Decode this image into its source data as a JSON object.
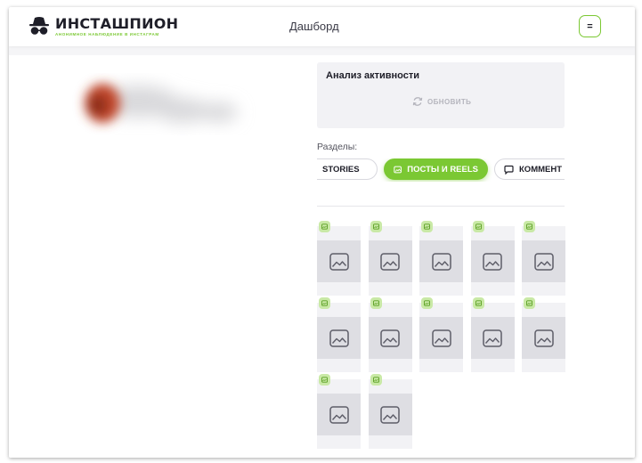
{
  "header": {
    "logo_name": "ИНСТАШПИОН",
    "logo_tagline": "анонимное наблюдение в инстаграм",
    "page_title": "Дашборд",
    "menu_label": "="
  },
  "activity": {
    "title": "Анализ активности",
    "refresh_label": "ОБНОВИТЬ"
  },
  "sections": {
    "label": "Разделы:",
    "tabs": [
      {
        "label": "STORIES",
        "icon": "stories-icon",
        "active": false
      },
      {
        "label": "ПОСТЫ И REELS",
        "icon": "image-icon",
        "active": true
      },
      {
        "label": "КОММЕНТ",
        "icon": "comment-icon",
        "active": false
      }
    ]
  },
  "posts": {
    "count": 12,
    "badge_icon": "image-icon",
    "placeholder_icon": "image-placeholder-icon"
  },
  "colors": {
    "accent": "#7bc833",
    "badge": "#c9e9a6",
    "placeholder": "#dedee3"
  }
}
